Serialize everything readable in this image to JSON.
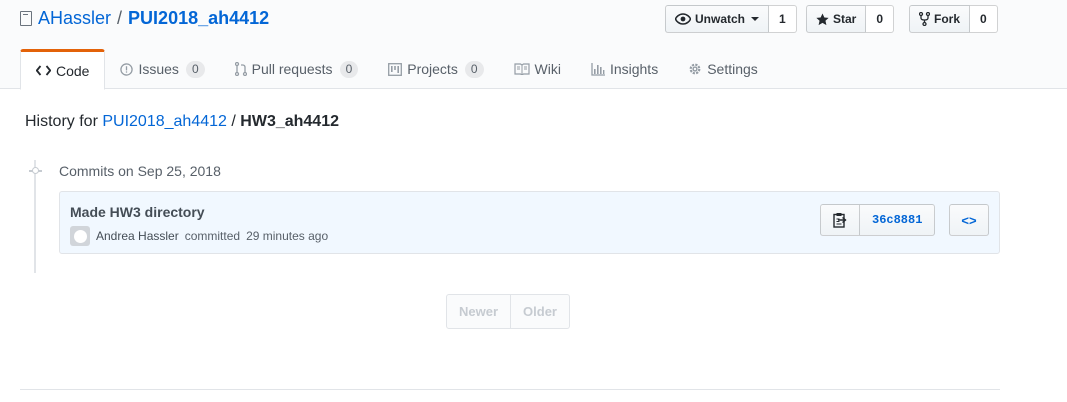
{
  "repo": {
    "owner": "AHassler",
    "separator": "/",
    "name": "PUI2018_ah4412"
  },
  "actions": {
    "watch_label": "Unwatch",
    "watch_count": "1",
    "star_label": "Star",
    "star_count": "0",
    "fork_label": "Fork",
    "fork_count": "0"
  },
  "tabs": [
    {
      "label": "Code",
      "icon": "code-icon"
    },
    {
      "label": "Issues",
      "count": "0",
      "icon": "issue-icon"
    },
    {
      "label": "Pull requests",
      "count": "0",
      "icon": "pull-request-icon"
    },
    {
      "label": "Projects",
      "count": "0",
      "icon": "project-icon"
    },
    {
      "label": "Wiki",
      "icon": "book-icon"
    },
    {
      "label": "Insights",
      "icon": "graph-icon"
    },
    {
      "label": "Settings",
      "icon": "gear-icon"
    }
  ],
  "history": {
    "prefix": "History for",
    "repo_link": "PUI2018_ah4412",
    "separator": "/",
    "path": "HW3_ah4412"
  },
  "commit_group": {
    "heading": "Commits on Sep 25, 2018"
  },
  "commit": {
    "title": "Made HW3 directory",
    "author": "Andrea Hassler",
    "action": "committed",
    "time": "29 minutes ago",
    "sha": "36c8881",
    "browse_label": "<>"
  },
  "pagination": {
    "newer": "Newer",
    "older": "Older"
  },
  "colors": {
    "link": "#0366d6",
    "tab_accent": "#e36209",
    "commit_bg": "#f1f8ff"
  }
}
